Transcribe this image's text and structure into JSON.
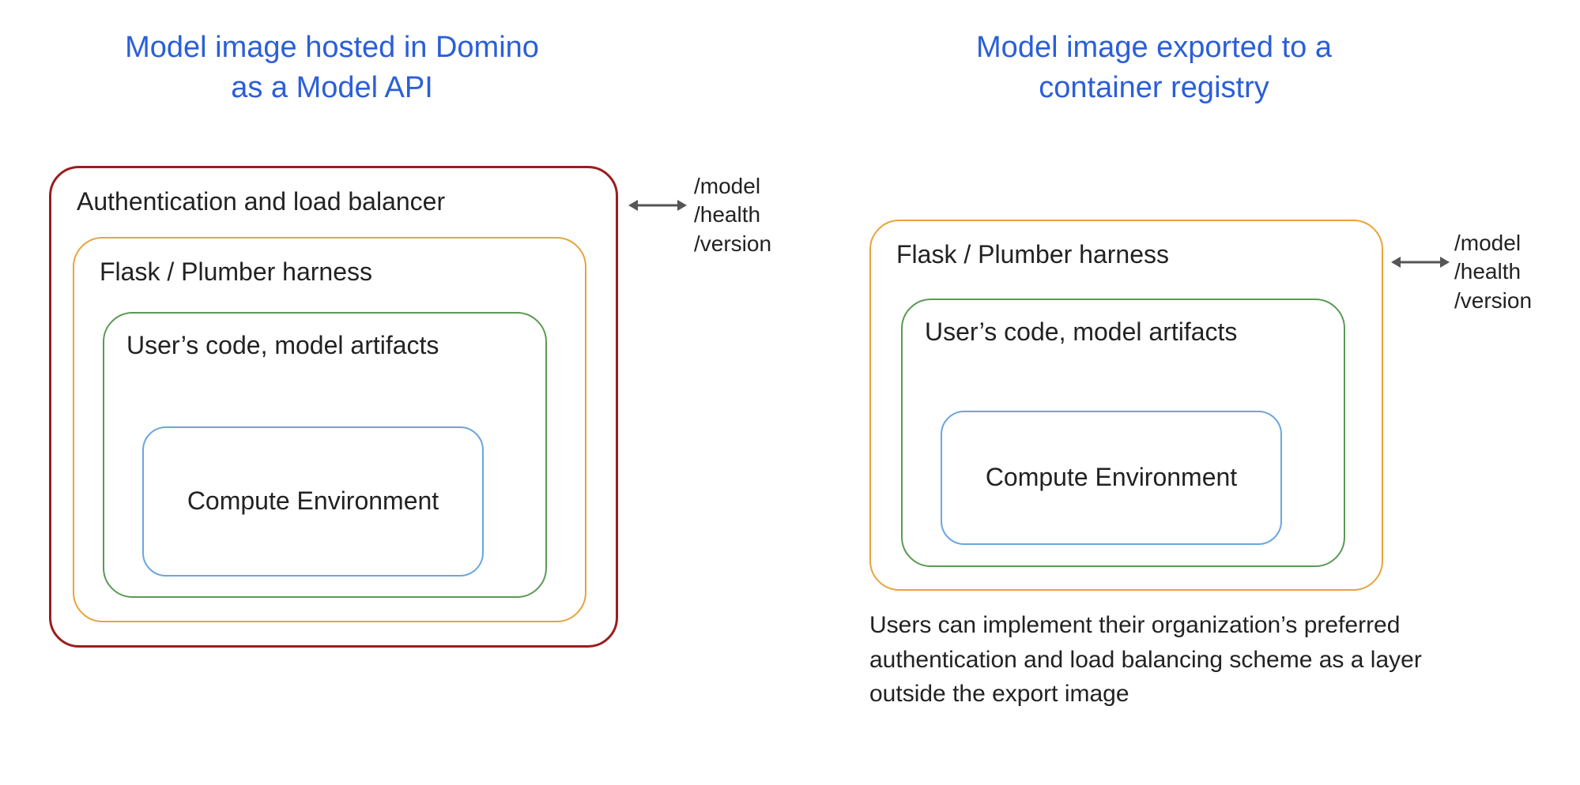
{
  "titles": {
    "left_line1": "Model image hosted in Domino",
    "left_line2": "as a Model API",
    "right_line1": "Model image exported to a",
    "right_line2": "container registry"
  },
  "left_stack": {
    "auth": "Authentication and load balancer",
    "harness": "Flask / Plumber harness",
    "user_code": "User’s code, model artifacts",
    "compute_env": "Compute Environment"
  },
  "right_stack": {
    "harness": "Flask / Plumber harness",
    "user_code": "User’s code, model artifacts",
    "compute_env": "Compute Environment"
  },
  "endpoints": {
    "model": "/model",
    "health": "/health",
    "version": "/version"
  },
  "right_caption": "Users can implement their organization’s preferred authentication and load balancing scheme as a layer outside the export image",
  "colors": {
    "title": "#2b5fd8",
    "auth_border": "#9a1e1e",
    "harness_border": "#e8a33b",
    "user_border": "#5a9a54",
    "env_border": "#6aa6e0"
  }
}
